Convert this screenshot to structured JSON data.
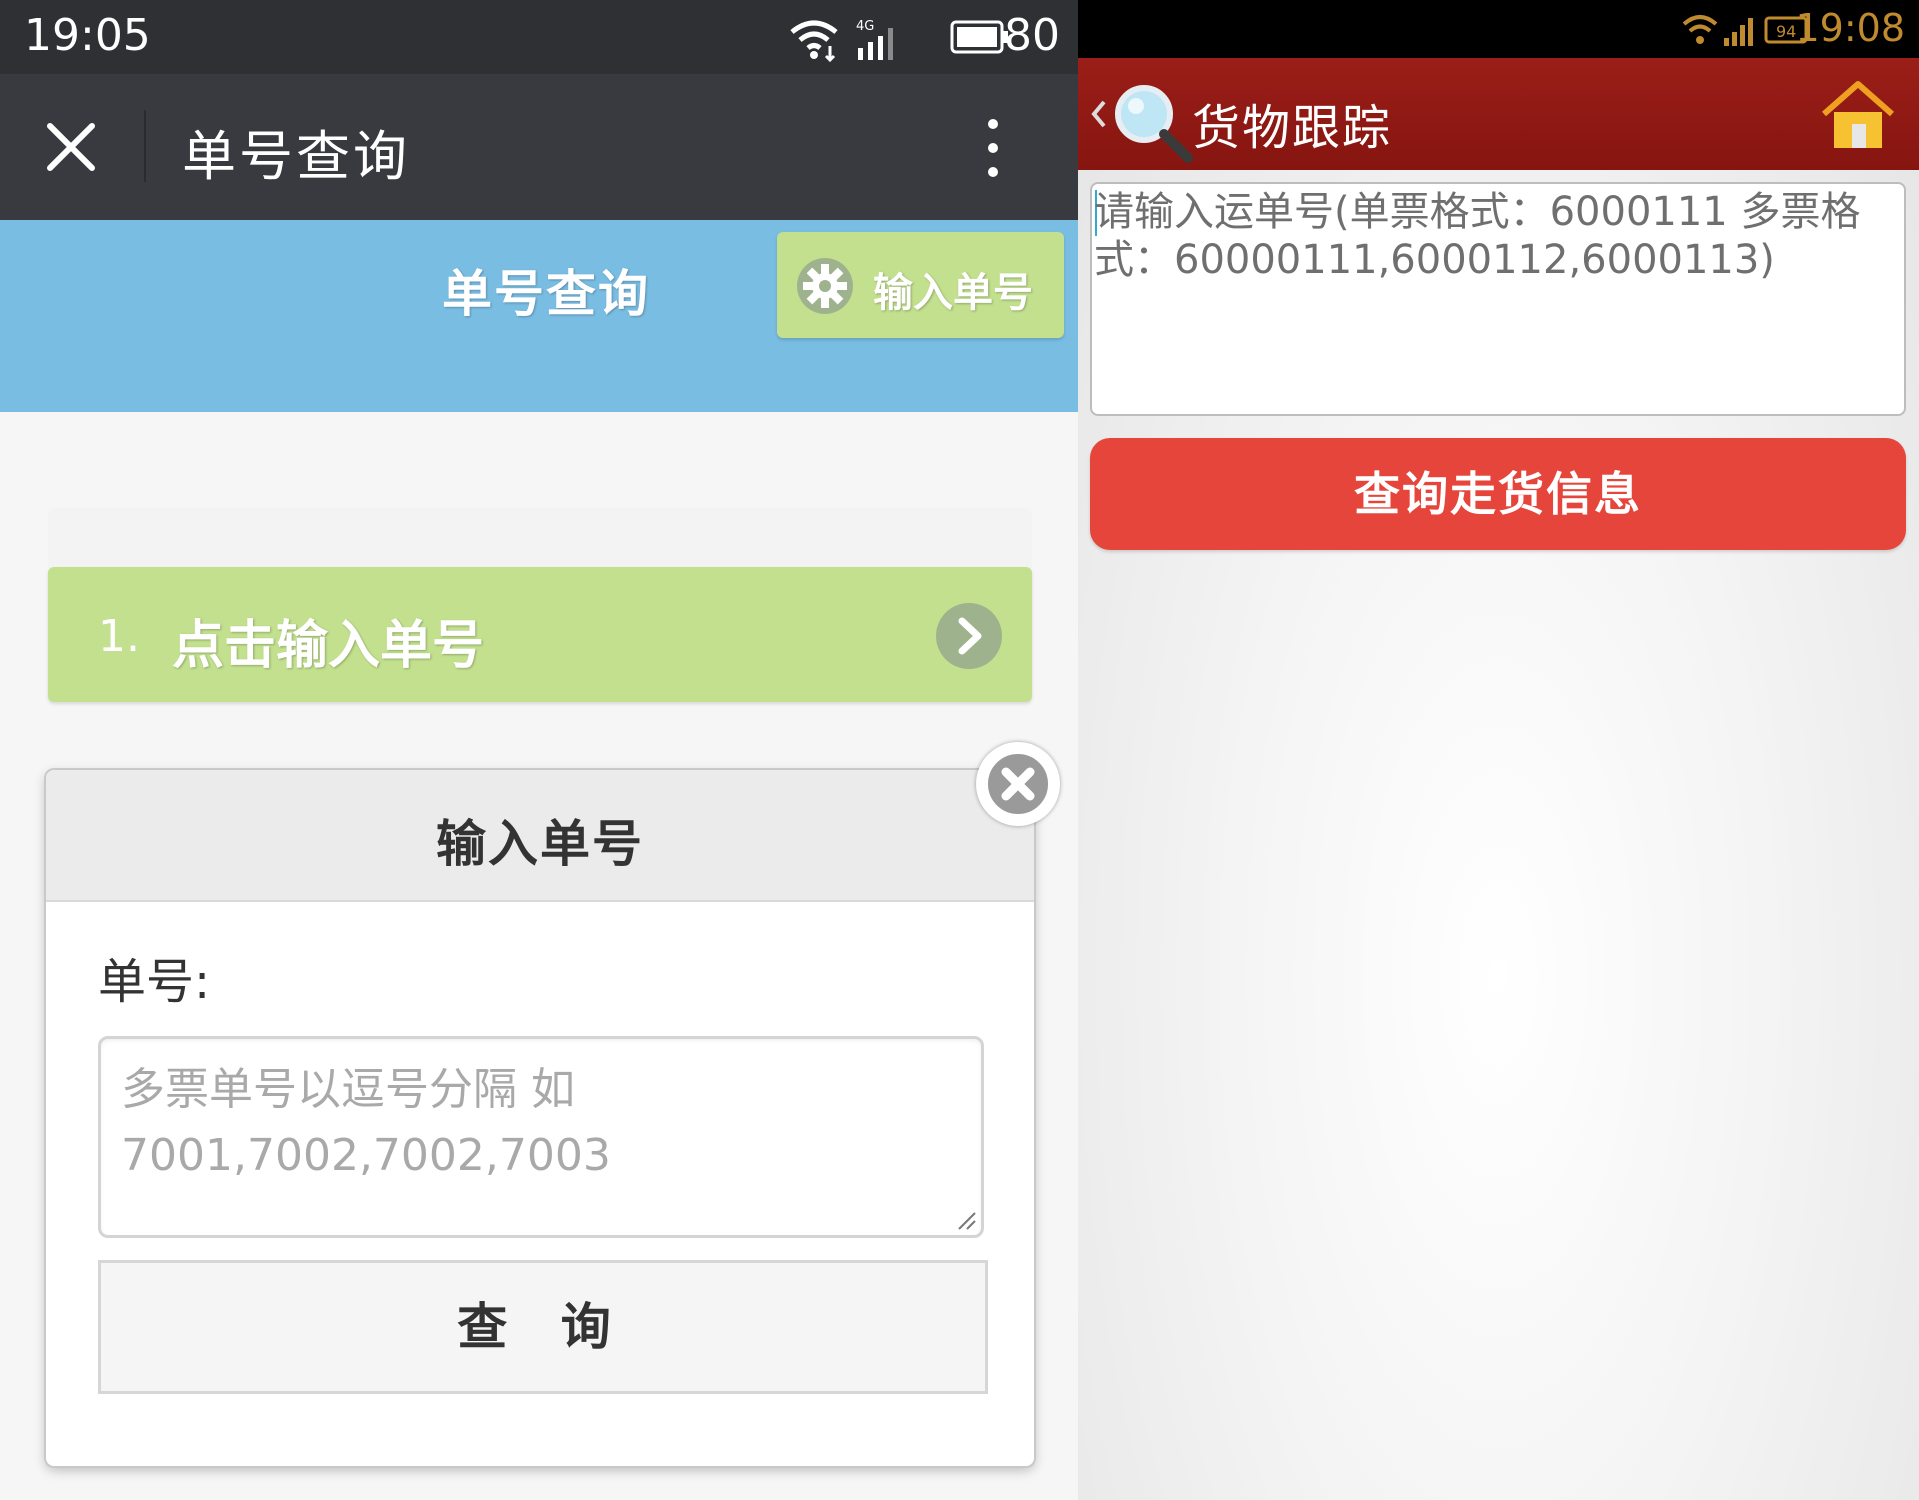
{
  "left": {
    "status_bar": {
      "time": "19:05",
      "network": "4G",
      "battery": "80"
    },
    "titlebar": {
      "title": "单号查询",
      "close_icon": "close-icon",
      "more_icon": "more-vertical-icon"
    },
    "header": {
      "title": "单号查询",
      "input_button_label": "输入单号",
      "input_button_icon": "gear-icon"
    },
    "list": {
      "items": [
        {
          "number": "1.",
          "label": "点击输入单号",
          "icon": "chevron-right-icon"
        }
      ]
    },
    "modal": {
      "title": "输入单号",
      "field_label": "单号:",
      "placeholder": "多票单号以逗号分隔 如 7001,7002,7002,7003",
      "submit_label": "查 询",
      "close_icon": "close-circle-icon"
    },
    "colors": {
      "header_bg": "#79bde3",
      "accent_green": "#c2e08d",
      "titlebar_bg": "#393a3f"
    }
  },
  "right": {
    "status_bar": {
      "time": "19:08",
      "battery": "94"
    },
    "titlebar": {
      "title": "货物跟踪",
      "back_icon": "back-icon",
      "search_icon": "magnifier-icon",
      "home_icon": "home-icon"
    },
    "tracking_input": {
      "placeholder": "请输入运单号(单票格式：6000111 多票格式：60000111,6000112,6000113)"
    },
    "submit_label": "查询走货信息",
    "colors": {
      "titlebar_bg": "#8f1913",
      "button_bg": "#e5453a"
    }
  }
}
